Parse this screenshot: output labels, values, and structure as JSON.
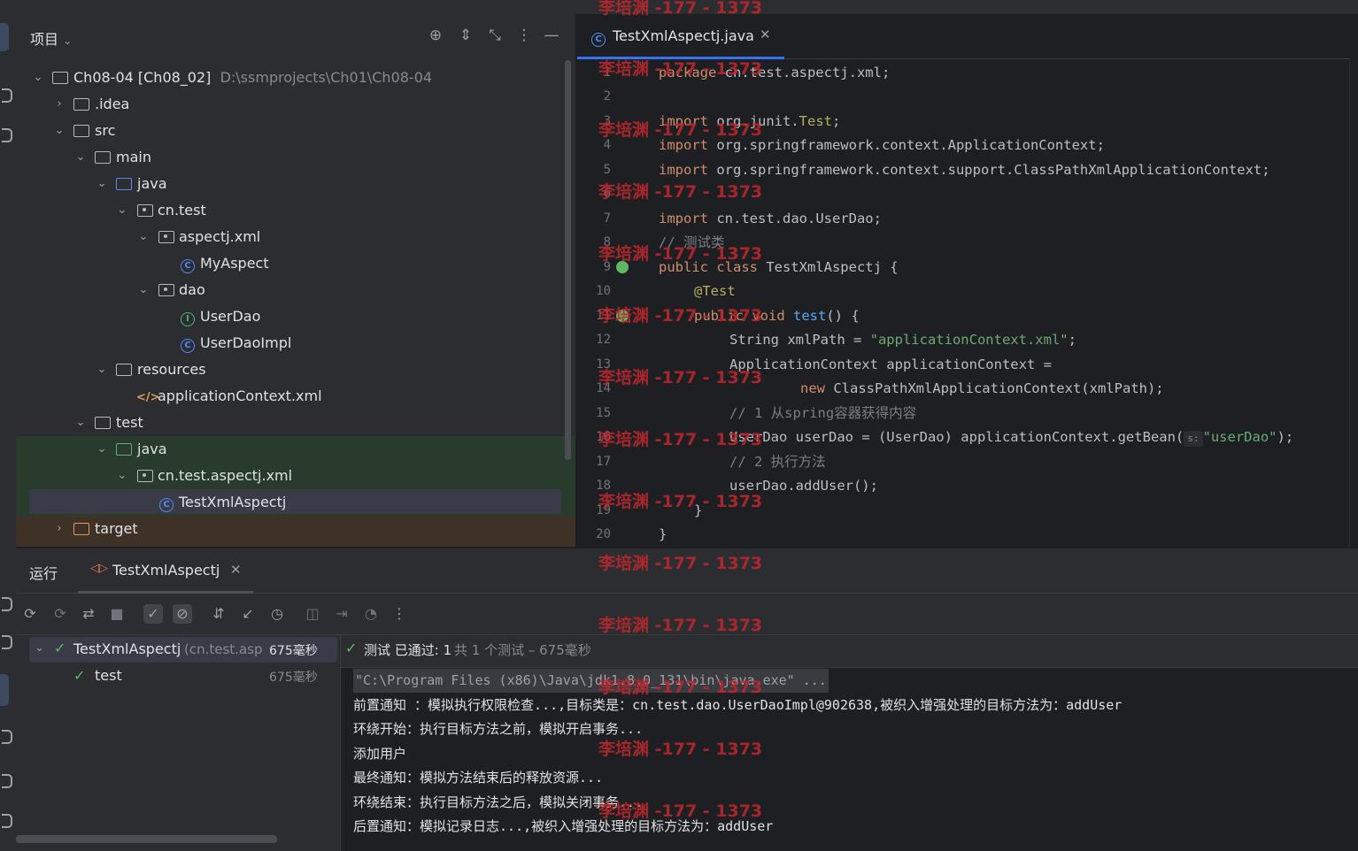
{
  "project_panel": {
    "title": "项目",
    "tree": [
      {
        "label": "Ch08-04 [Ch08_02]",
        "hint": "D:\\ssmprojects\\Ch01\\Ch08-04"
      },
      {
        "label": ".idea"
      },
      {
        "label": "src"
      },
      {
        "label": "main"
      },
      {
        "label": "java"
      },
      {
        "label": "cn.test"
      },
      {
        "label": "aspectj.xml"
      },
      {
        "label": "MyAspect"
      },
      {
        "label": "dao"
      },
      {
        "label": "UserDao"
      },
      {
        "label": "UserDaoImpl"
      },
      {
        "label": "resources"
      },
      {
        "label": "applicationContext.xml"
      },
      {
        "label": "test"
      },
      {
        "label": "java"
      },
      {
        "label": "cn.test.aspectj.xml"
      },
      {
        "label": "TestXmlAspectj"
      },
      {
        "label": "target"
      }
    ]
  },
  "editor": {
    "tab_label": "TestXmlAspectj.java",
    "line_numbers": [
      "1",
      "2",
      "3",
      "4",
      "5",
      "6",
      "7",
      "8",
      "9",
      "10",
      "11",
      "12",
      "13",
      "14",
      "15",
      "16",
      "17",
      "18",
      "19",
      "20"
    ],
    "code": {
      "l1_kw": "package",
      "l1_rest": " cn.test.aspectj.xml;",
      "l3_kw": "import",
      "l3_pkg": " org.junit.",
      "l3_cls": "Test",
      "l3_end": ";",
      "l4_kw": "import",
      "l4_rest": " org.springframework.context.ApplicationContext;",
      "l5_kw": "import",
      "l5_rest": " org.springframework.context.support.ClassPathXmlApplicationContext;",
      "l7_kw": "import",
      "l7_rest": " cn.test.dao.UserDao;",
      "l8_comment": "// 测试类",
      "l9_kw": "public class",
      "l9_rest": " TestXmlAspectj {",
      "l10_ann": "@Test",
      "l11_kw": "public void",
      "l11_fn": " test",
      "l11_rest": "() {",
      "l12_pre": "String xmlPath = ",
      "l12_str": "\"applicationContext.xml\"",
      "l12_end": ";",
      "l13": "ApplicationContext applicationContext =",
      "l14_kw": "new",
      "l14_rest": " ClassPathXmlApplicationContext(xmlPath);",
      "l15_comment": "// 1 从spring容器获得内容",
      "l16_pre": "UserDao userDao = (UserDao) applicationContext.getBean(",
      "l16_hint": "s:",
      "l16_str": "\"userDao\"",
      "l16_end": ");",
      "l17_comment": "// 2 执行方法",
      "l18": "userDao.addUser();",
      "l19": "}",
      "l20": "}"
    }
  },
  "run_panel": {
    "title": "运行",
    "tab_label": "TestXmlAspectj",
    "tree": {
      "root_label": "TestXmlAspectj",
      "root_hint": "(cn.test.asp",
      "root_time": "675毫秒",
      "child_label": "test",
      "child_time": "675毫秒"
    },
    "status": {
      "passed": "测试 已通过: 1",
      "summary": "共 1 个测试 – 675毫秒"
    },
    "console_lines": [
      "\"C:\\Program Files (x86)\\Java\\jdk1.8.0_131\\bin\\java.exe\" ...",
      "前置通知 ：模拟执行权限检查...,目标类是：cn.test.dao.UserDaoImpl@902638,被织入增强处理的目标方法为：addUser",
      "环绕开始：执行目标方法之前，模拟开启事务...",
      "添加用户",
      "最终通知：模拟方法结束后的释放资源...",
      "环绕结束：执行目标方法之后，模拟关闭事务...",
      "后置通知：模拟记录日志...,被织入增强处理的目标方法为：addUser"
    ]
  },
  "watermark": {
    "text": "李培渊 -177 - 1373"
  },
  "colors": {
    "accent": "#3574f0",
    "pass_green": "#5fb865",
    "watermark_red": "#c0282e",
    "keyword": "#cf8e6d",
    "string": "#6aab73"
  }
}
